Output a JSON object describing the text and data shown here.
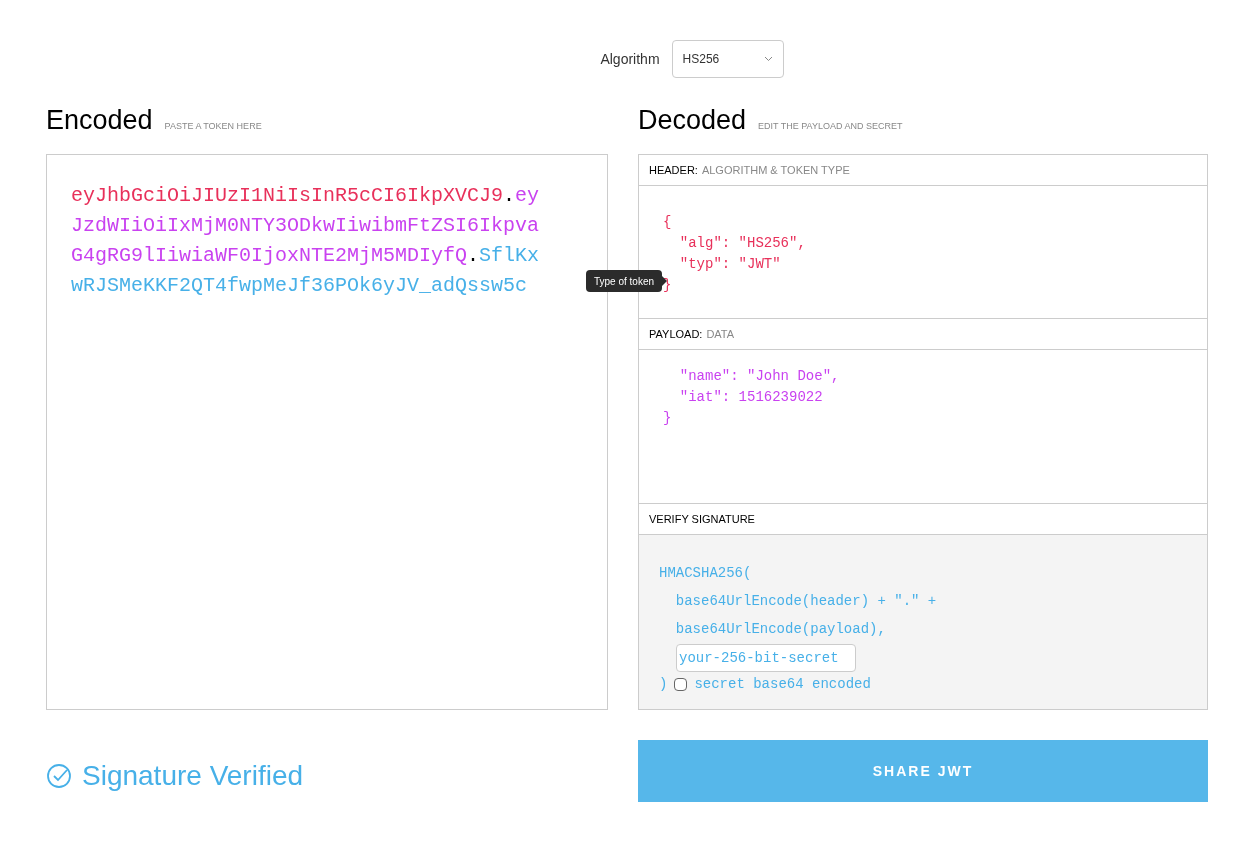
{
  "algorithm": {
    "label": "Algorithm",
    "value": "HS256"
  },
  "encoded": {
    "title": "Encoded",
    "hint": "PASTE A TOKEN HERE",
    "lines": [
      [
        {
          "kind": "header",
          "text": "eyJhbGciOiJIUzI1NiIsInR5cCI6IkpXVCJ9"
        },
        {
          "kind": "dot",
          "text": "."
        },
        {
          "kind": "payload",
          "text": "ey"
        }
      ],
      [
        {
          "kind": "payload",
          "text": "JzdWIiOiIxMjM0NTY3ODkwIiwibmFtZSI6Ikpva"
        }
      ],
      [
        {
          "kind": "payload",
          "text": "G4gRG9lIiwiaWF0IjoxNTE2MjM5MDIyfQ"
        },
        {
          "kind": "dot",
          "text": "."
        },
        {
          "kind": "signature",
          "text": "SflKx"
        }
      ],
      [
        {
          "kind": "signature",
          "text": "wRJSMeKKF2QT4fwpMeJf36POk6yJV_adQssw5c"
        }
      ]
    ]
  },
  "tooltip": "Type of token",
  "decoded": {
    "title": "Decoded",
    "hint": "EDIT THE PAYLOAD AND SECRET",
    "header": {
      "label": "HEADER:",
      "sublabel": "ALGORITHM & TOKEN TYPE",
      "lines": [
        "{",
        "  \"alg\": \"HS256\",",
        "  \"typ\": \"JWT\"",
        "}"
      ]
    },
    "payload": {
      "label": "PAYLOAD:",
      "sublabel": "DATA",
      "lines": [
        "  \"name\": \"John Doe\",",
        "  \"iat\": 1516239022",
        "}"
      ]
    },
    "verify": {
      "label": "VERIFY SIGNATURE",
      "lines": [
        "HMACSHA256(",
        "  base64UrlEncode(header) + \".\" +",
        "  base64UrlEncode(payload),"
      ],
      "secret": "your-256-bit-secret",
      "close": ")",
      "checkbox": {
        "label": "secret base64 encoded",
        "checked": false
      }
    }
  },
  "status": {
    "text": "Signature Verified",
    "verified": true
  },
  "share_button": "SHARE JWT"
}
